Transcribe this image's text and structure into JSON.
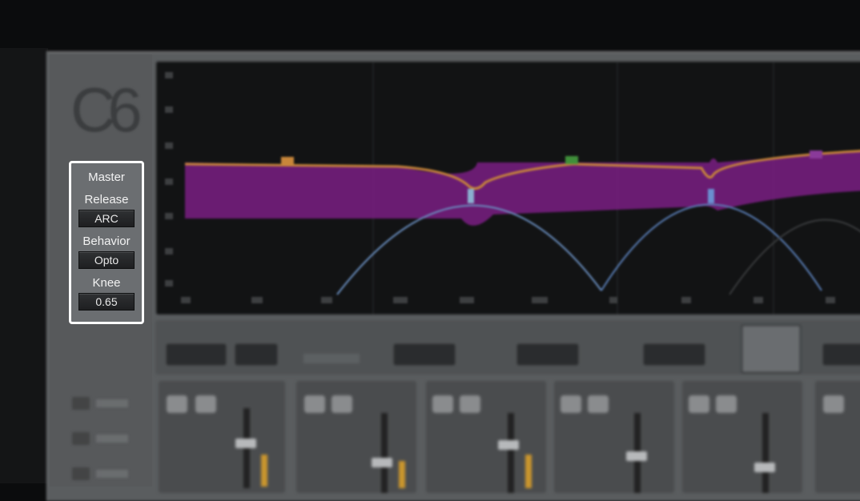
{
  "master_panel": {
    "title": "Master",
    "release": {
      "label": "Release",
      "value": "ARC"
    },
    "behavior": {
      "label": "Behavior",
      "value": "Opto"
    },
    "knee": {
      "label": "Knee",
      "value": "0.65"
    }
  },
  "logo_text": "C6",
  "colors": {
    "background": "#0b0c0d",
    "panel": "#5a5d5f",
    "graph_bg": "#121314",
    "purple_band": "#7a1f83",
    "orange_curve": "#c8863a",
    "blue_curve": "#6a8fc0",
    "highlight_border": "#ffffff",
    "fader_gold": "#c9952e"
  }
}
